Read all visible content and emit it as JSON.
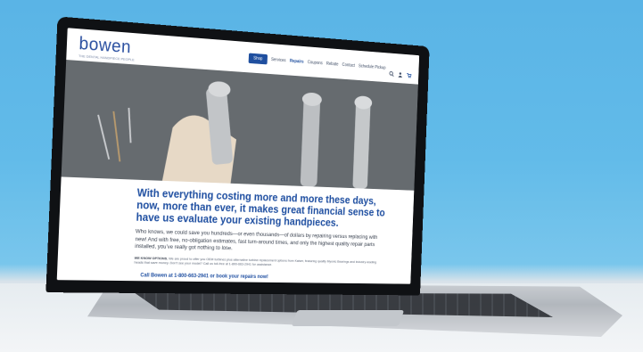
{
  "site": {
    "logo": "bowen",
    "tagline": "THE DENTAL HANDPIECE PEOPLE",
    "nav": {
      "cta": "Shop",
      "items": [
        "Services",
        "Repairs",
        "Coupons",
        "Rebate",
        "Contact",
        "Schedule Pickup"
      ],
      "active_index": 1
    }
  },
  "content": {
    "headline": "With everything costing more and more these days, now, more than ever, it makes great financial sense to have us evaluate your existing handpieces.",
    "paragraph": "Who knows, we could save you hundreds—or even thousands—of dollars by repairing versus replacing with new! And with free, no-obligation estimates, fast turn-around times, and only the highest quality repair parts installed, you’ve really got nothing to lose.",
    "options_title": "WE KNOW OPTIONS.",
    "options_text": "We are proud to offer you OEM turbines plus alternative turbine replacement options from Kaiser, featuring quality Myonic Bearings and industry-leading heads that save money. Don’t see your model? Call us toll-free at 1-800-663-2941 for assistance.",
    "cta": "Call Bowen at 1-800-663-2941 or book your repairs now!"
  },
  "colors": {
    "brand": "#1f4f9f",
    "background": "#62bbe9"
  }
}
